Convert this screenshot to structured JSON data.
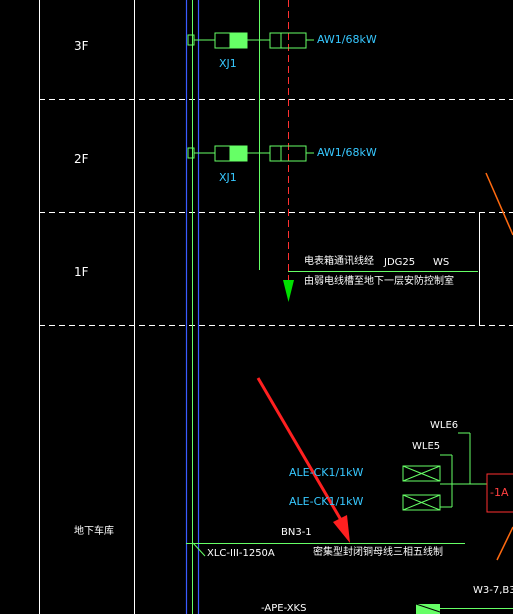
{
  "floors": {
    "f3": "3F",
    "f2": "2F",
    "f1": "1F",
    "basement": "地下车库"
  },
  "row3f": {
    "left_tag": "XJ1",
    "feeder": "AW1/68kW"
  },
  "row2f": {
    "left_tag": "XJ1",
    "feeder": "AW1/68kW"
  },
  "note_1f": {
    "line1_left": "电表箱通讯线经",
    "line1_mid": "JDG25",
    "line1_right": "WS",
    "line2": "由弱电线槽至地下一层安防控制室"
  },
  "basement_panel": {
    "wle6": "WLE6",
    "wle5": "WLE5",
    "ale1": "ALE-CK1/1kW",
    "ale2": "ALE-CK1/1kW",
    "right_box": "-1A"
  },
  "busway": {
    "bn": "BN3-1",
    "xlc": "XLC-III-1250A",
    "desc": "密集型封闭铜母线三相五线制",
    "ape": "-APE-XKS",
    "w3": "W3-7,B3"
  },
  "colors": {
    "background": "#000000",
    "grid": "#ffffff",
    "feeder_line": "#66ff66",
    "bus_blue": "#3a5bff",
    "cyan_text": "#37c8ff",
    "red": "#ff3030",
    "orange": "#ff6a10",
    "annotation_arrow": "#ff2020"
  }
}
